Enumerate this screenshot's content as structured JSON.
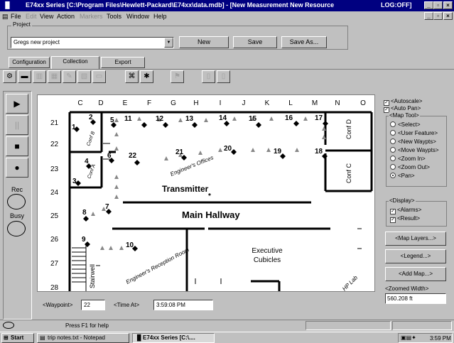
{
  "window": {
    "title": "E74xx Series [C:\\Program Files\\Hewlett-Packard\\E74xx\\data.mdb] - [New Measurement    New Resource",
    "log_status": "LOG:OFF]",
    "controls": [
      "_",
      "▫",
      "×"
    ]
  },
  "menu": {
    "items": [
      {
        "label": "File",
        "disabled": false
      },
      {
        "label": "Edit",
        "disabled": true
      },
      {
        "label": "View",
        "disabled": false
      },
      {
        "label": "Action",
        "disabled": false
      },
      {
        "label": "Markers",
        "disabled": true
      },
      {
        "label": "Tools",
        "disabled": false
      },
      {
        "label": "Window",
        "disabled": false
      },
      {
        "label": "Help",
        "disabled": false
      }
    ]
  },
  "project": {
    "group_label": "Project",
    "selected": "Gregs new project",
    "new_label": "New",
    "save_label": "Save",
    "save_as_label": "Save As..."
  },
  "tabs": [
    "Configuration",
    "Collection",
    "Export"
  ],
  "left_panel": {
    "play_icon": "▶",
    "pause_icon": "||",
    "stop_icon": "■",
    "record_icon": "●",
    "rec_label": "Rec",
    "busy_label": "Busy"
  },
  "map": {
    "columns": [
      "C",
      "D",
      "E",
      "F",
      "G",
      "H",
      "I",
      "J",
      "K",
      "L",
      "M",
      "N",
      "O"
    ],
    "rows": [
      "21",
      "22",
      "23",
      "24",
      "25",
      "26",
      "27",
      "28"
    ],
    "transmitter_label": "Transmitter",
    "hallway_label": "Main Hallway",
    "cubicles_label_1": "Executive",
    "cubicles_label_2": "Cubicles",
    "conf_d": "Conf D",
    "conf_c": "Conf C",
    "stairwell": "Stairwell",
    "engineers_offices": "Engineer's Offices",
    "engineers_reception": "Engineer's Reception Room",
    "conf_b": "Conf B",
    "conf_a": "Conf A",
    "lab": "HP Lab",
    "waypoints": [
      "1",
      "2",
      "3",
      "4",
      "5",
      "6",
      "7",
      "8",
      "9",
      "10",
      "11",
      "12",
      "13",
      "14",
      "15",
      "16",
      "17",
      "18",
      "19",
      "20",
      "21",
      "22"
    ]
  },
  "right_panel": {
    "autoscale": "<Autoscale>",
    "autopan": "<Auto Pan>",
    "map_tool_label": "<Map Tool>",
    "tools": [
      {
        "label": "<Select>",
        "selected": false
      },
      {
        "label": "<User Feature>",
        "selected": false
      },
      {
        "label": "<New Waypts>",
        "selected": false
      },
      {
        "label": "<Move Waypts>",
        "selected": false
      },
      {
        "label": "<Zoom In>",
        "selected": false
      },
      {
        "label": "<Zoom Out>",
        "selected": false
      },
      {
        "label": "<Pan>",
        "selected": true
      }
    ],
    "display_label": "<Display>",
    "alarms": "<Alarms>",
    "result": "<Result>",
    "map_layers": "<Map Layers...>",
    "legend": "<Legend...>",
    "add_map": "<Add Map...>",
    "zoomed_width_label": "<Zoomed Width>",
    "zoomed_width_value": "560.208 ft"
  },
  "bottom": {
    "waypoint_label": "<Waypoint>",
    "waypoint_value": "22",
    "time_label": "<Time At>",
    "time_value": "3:59:08 PM"
  },
  "status": {
    "help": "Press F1 for help"
  },
  "taskbar": {
    "start": "Start",
    "notepad": "trip notes.txt - Notepad",
    "app": "E74xx Series [C:\\....",
    "clock": "3:59 PM"
  }
}
